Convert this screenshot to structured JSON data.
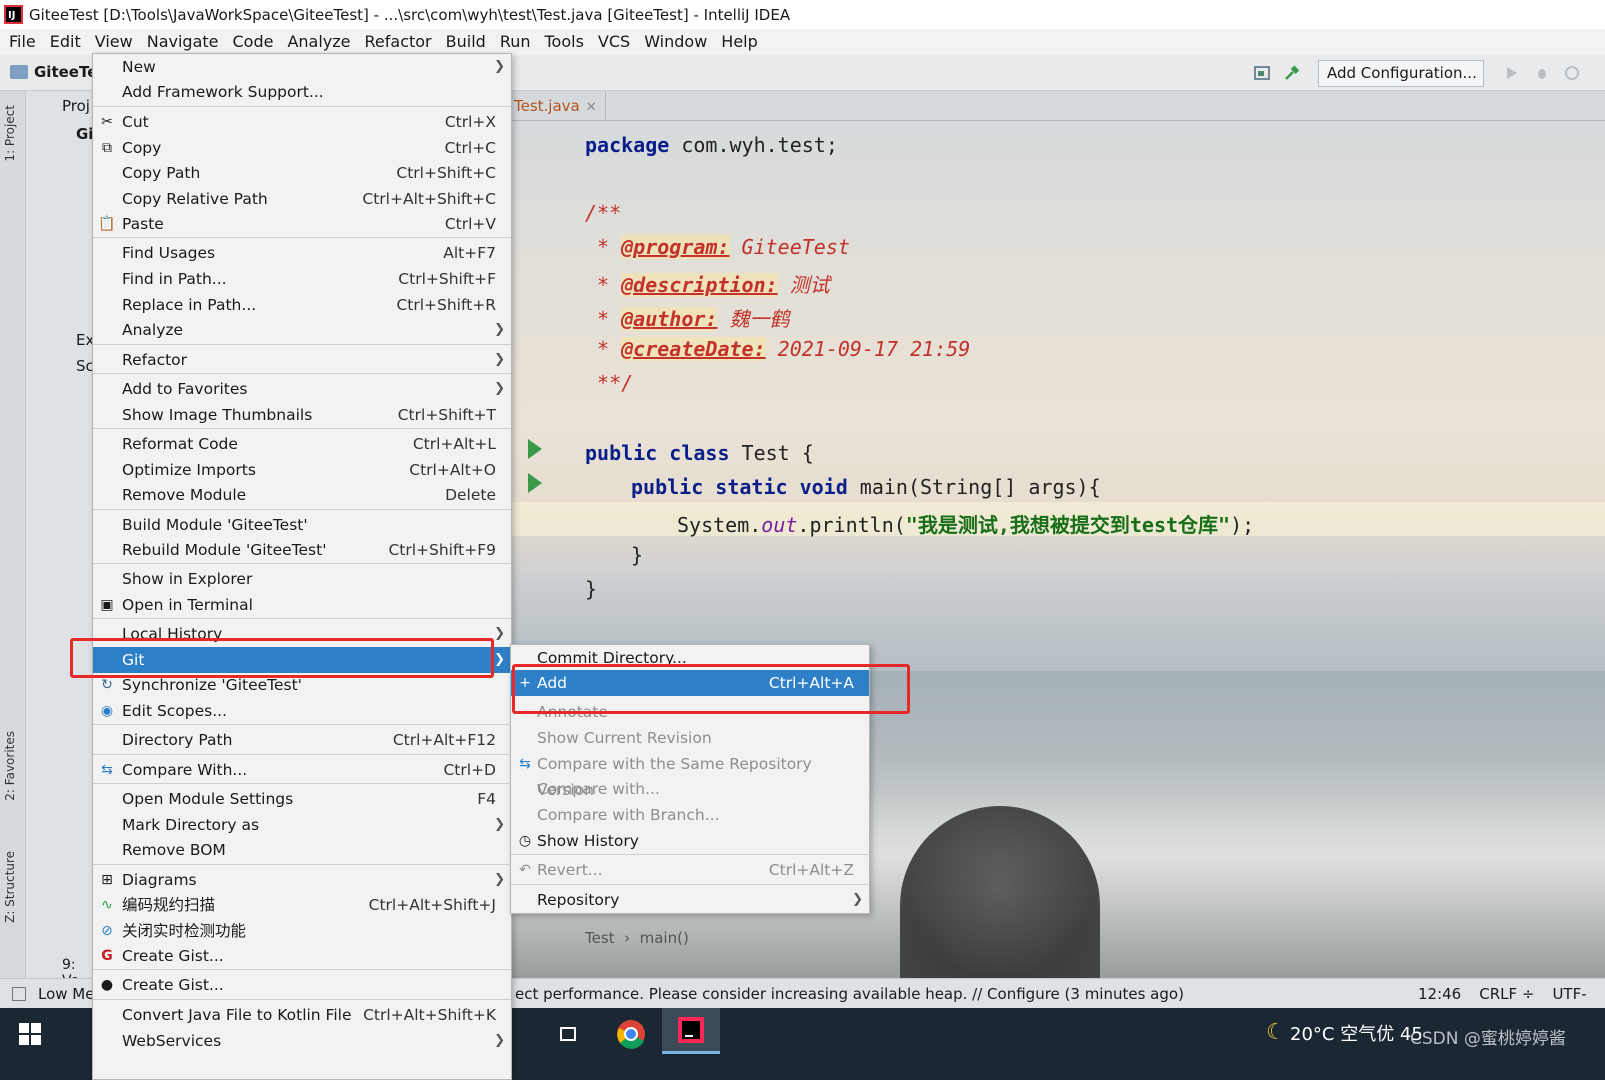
{
  "window": {
    "title": "GiteeTest [D:\\Tools\\JavaWorkSpace\\GiteeTest] - ...\\src\\com\\wyh\\test\\Test.java [GiteeTest] - IntelliJ IDEA"
  },
  "menubar": [
    "File",
    "Edit",
    "View",
    "Navigate",
    "Code",
    "Analyze",
    "Refactor",
    "Build",
    "Run",
    "Tools",
    "VCS",
    "Window",
    "Help"
  ],
  "toolbar": {
    "project_crumb": "GiteeTe",
    "add_configuration": "Add Configuration..."
  },
  "project_panel": {
    "items": [
      "Proj",
      "Gi",
      "Ex",
      "Sc"
    ],
    "bottom": "9: Ve"
  },
  "side_tabs": {
    "project": "1: Project",
    "favorites": "2: Favorites",
    "structure": "Z: Structure"
  },
  "editor": {
    "tab": "Test.java",
    "breadcrumb_class": "Test",
    "breadcrumb_method": "main()",
    "code": {
      "package_kw": "package",
      "package_name": " com.wyh.test;",
      "doc_open": "/**",
      "tag_program": "@program:",
      "val_program": " GiteeTest",
      "tag_description": "@description:",
      "val_description": " 测试",
      "tag_author": "@author:",
      "val_author": " 魏一鹤",
      "tag_createDate": "@createDate:",
      "val_createDate": " 2021-09-17 21:59",
      "doc_close": " **/",
      "star": " * ",
      "class_kw": "public class",
      "class_name": " Test {",
      "main_kw": "public static void",
      "main_sig": " main(String[] args){",
      "println_prefix": "System.",
      "println_field": "out",
      "println_call": ".println(",
      "println_str": "\"我是测试,我想被提交到test仓库\"",
      "println_end": ");",
      "brace_inner": "}",
      "brace_outer": "}"
    }
  },
  "context_menu": [
    {
      "label": "New",
      "shortcut": "",
      "submenu": true,
      "icon": ""
    },
    {
      "label": "Add Framework Support...",
      "shortcut": "",
      "icon": ""
    },
    {
      "label": "Cut",
      "shortcut": "Ctrl+X",
      "icon": "scissors-icon"
    },
    {
      "label": "Copy",
      "shortcut": "Ctrl+C",
      "icon": "copy-icon"
    },
    {
      "label": "Copy Path",
      "shortcut": "Ctrl+Shift+C",
      "icon": ""
    },
    {
      "label": "Copy Relative Path",
      "shortcut": "Ctrl+Alt+Shift+C",
      "icon": ""
    },
    {
      "label": "Paste",
      "shortcut": "Ctrl+V",
      "icon": "paste-icon"
    },
    {
      "label": "Find Usages",
      "shortcut": "Alt+F7",
      "icon": ""
    },
    {
      "label": "Find in Path...",
      "shortcut": "Ctrl+Shift+F",
      "icon": ""
    },
    {
      "label": "Replace in Path...",
      "shortcut": "Ctrl+Shift+R",
      "icon": ""
    },
    {
      "label": "Analyze",
      "shortcut": "",
      "submenu": true,
      "icon": ""
    },
    {
      "label": "Refactor",
      "shortcut": "",
      "submenu": true,
      "icon": ""
    },
    {
      "label": "Add to Favorites",
      "shortcut": "",
      "submenu": true,
      "icon": ""
    },
    {
      "label": "Show Image Thumbnails",
      "shortcut": "Ctrl+Shift+T",
      "icon": ""
    },
    {
      "label": "Reformat Code",
      "shortcut": "Ctrl+Alt+L",
      "icon": ""
    },
    {
      "label": "Optimize Imports",
      "shortcut": "Ctrl+Alt+O",
      "icon": ""
    },
    {
      "label": "Remove Module",
      "shortcut": "Delete",
      "icon": ""
    },
    {
      "label": "Build Module 'GiteeTest'",
      "shortcut": "",
      "icon": ""
    },
    {
      "label": "Rebuild Module 'GiteeTest'",
      "shortcut": "Ctrl+Shift+F9",
      "icon": ""
    },
    {
      "label": "Show in Explorer",
      "shortcut": "",
      "icon": ""
    },
    {
      "label": "Open in Terminal",
      "shortcut": "",
      "icon": "terminal-icon"
    },
    {
      "label": "Local History",
      "shortcut": "",
      "submenu": true,
      "icon": ""
    },
    {
      "label": "Git",
      "shortcut": "",
      "submenu": true,
      "icon": "",
      "selected": true
    },
    {
      "label": "Synchronize 'GiteeTest'",
      "shortcut": "",
      "icon": "sync-icon"
    },
    {
      "label": "Edit Scopes...",
      "shortcut": "",
      "icon": "scope-icon"
    },
    {
      "label": "Directory Path",
      "shortcut": "Ctrl+Alt+F12",
      "icon": ""
    },
    {
      "label": "Compare With...",
      "shortcut": "Ctrl+D",
      "icon": "compare-icon"
    },
    {
      "label": "Open Module Settings",
      "shortcut": "F4",
      "icon": ""
    },
    {
      "label": "Mark Directory as",
      "shortcut": "",
      "submenu": true,
      "icon": ""
    },
    {
      "label": "Remove BOM",
      "shortcut": "",
      "icon": ""
    },
    {
      "label": "Diagrams",
      "shortcut": "",
      "submenu": true,
      "icon": "diagram-icon"
    },
    {
      "label": "编码规约扫描",
      "shortcut": "Ctrl+Alt+Shift+J",
      "icon": "scan-icon"
    },
    {
      "label": "关闭实时检测功能",
      "shortcut": "",
      "icon": "disable-icon"
    },
    {
      "label": "Create Gist...",
      "shortcut": "",
      "icon": "gitee-icon"
    },
    {
      "label": "Create Gist...",
      "shortcut": "",
      "icon": "github-icon"
    },
    {
      "label": "Convert Java File to Kotlin File",
      "shortcut": "Ctrl+Alt+Shift+K",
      "icon": ""
    },
    {
      "label": "WebServices",
      "shortcut": "",
      "submenu": true,
      "icon": ""
    }
  ],
  "git_menu": [
    {
      "label": "Commit Directory...",
      "shortcut": "",
      "icon": ""
    },
    {
      "label": "Add",
      "shortcut": "Ctrl+Alt+A",
      "icon": "plus-icon",
      "selected": true
    },
    {
      "label": "Annotate",
      "shortcut": "",
      "disabled": true
    },
    {
      "label": "Show Current Revision",
      "shortcut": "",
      "disabled": true
    },
    {
      "label": "Compare with the Same Repository Version",
      "shortcut": "",
      "disabled": true,
      "icon": "compare-icon"
    },
    {
      "label": "Compare with...",
      "shortcut": "",
      "disabled": true
    },
    {
      "label": "Compare with Branch...",
      "shortcut": "",
      "disabled": true
    },
    {
      "label": "Show History",
      "shortcut": "",
      "icon": "clock-icon"
    },
    {
      "label": "Revert...",
      "shortcut": "Ctrl+Alt+Z",
      "disabled": true,
      "icon": "revert-icon"
    },
    {
      "label": "Repository",
      "shortcut": "",
      "submenu": true
    }
  ],
  "statusbar": {
    "low_memory": "Low Me",
    "message": "ect performance. Please consider increasing available heap. // Configure (3 minutes ago)",
    "time": "12:46",
    "line_ending": "CRLF ÷",
    "encoding": "UTF-"
  },
  "taskbar": {
    "weather": "20°C  空气优 45",
    "watermark": "CSDN @蜜桃婷婷酱"
  },
  "colors": {
    "selection": "#2d7fc8",
    "highlight_box": "#e82828",
    "keyword": "#0a1e8a",
    "comment": "#c2322a",
    "string": "#176e17"
  }
}
